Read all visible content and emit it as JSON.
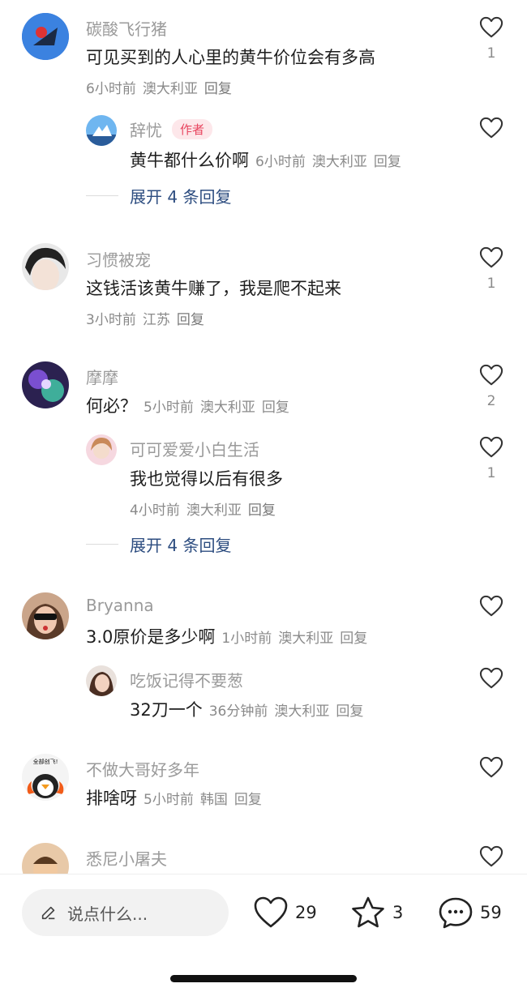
{
  "comments": [
    {
      "name": "碳酸飞行猪",
      "text": "可见买到的人心里的黄牛价位会有多高",
      "time": "6小时前",
      "location": "澳大利亚",
      "reply": "回复",
      "likes": "1",
      "replies": [
        {
          "name": "辞忧",
          "badge": "作者",
          "text": "黄牛都什么价啊",
          "time": "6小时前",
          "location": "澳大利亚",
          "reply": "回复"
        }
      ],
      "expand": "展开 4 条回复"
    },
    {
      "name": "习惯被宠",
      "text": "这钱活该黄牛赚了，我是爬不起来",
      "time": "3小时前",
      "location": "江苏",
      "reply": "回复",
      "likes": "1"
    },
    {
      "name": "摩摩",
      "text": "何必？",
      "time": "5小时前",
      "location": "澳大利亚",
      "reply": "回复",
      "likes": "2",
      "replies": [
        {
          "name": "可可爱爱小白生活",
          "text": "我也觉得以后有很多",
          "time": "4小时前",
          "location": "澳大利亚",
          "reply": "回复",
          "likes": "1"
        }
      ],
      "expand": "展开 4 条回复"
    },
    {
      "name": "Bryanna",
      "text": "3.0原价是多少啊",
      "time": "1小时前",
      "location": "澳大利亚",
      "reply": "回复",
      "replies": [
        {
          "name": "吃饭记得不要葱",
          "text": "32刀一个",
          "time": "36分钟前",
          "location": "澳大利亚",
          "reply": "回复"
        }
      ]
    },
    {
      "name": "不做大哥好多年",
      "text": "排啥呀",
      "time": "5小时前",
      "location": "韩国",
      "reply": "回复",
      "avatar_text": "全部创飞!"
    },
    {
      "name": "悉尼小屠夫"
    }
  ],
  "bottom_bar": {
    "input_placeholder": "说点什么...",
    "likes": "29",
    "favorites": "3",
    "comments": "59"
  },
  "colors": {
    "author_badge": "#e8455f",
    "expand_link": "#2d4d80",
    "secondary_text": "#9a9a9a"
  },
  "icons": {
    "like": "heart-outline-icon",
    "favorite": "star-outline-icon",
    "comment": "speech-bubble-icon",
    "edit": "pencil-icon"
  }
}
